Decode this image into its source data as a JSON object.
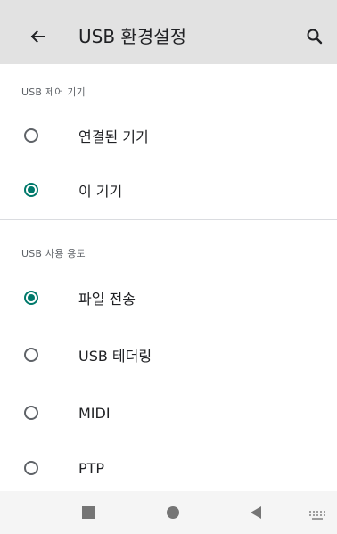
{
  "toolbar": {
    "title": "USB 환경설정",
    "back_icon": "arrow-left-icon",
    "search_icon": "search-icon"
  },
  "sections": [
    {
      "header": "USB 제어 기기",
      "options": [
        {
          "label": "연결된 기기",
          "selected": false
        },
        {
          "label": "이 기기",
          "selected": true
        }
      ]
    },
    {
      "header": "USB 사용 용도",
      "options": [
        {
          "label": "파일 전송",
          "selected": true
        },
        {
          "label": "USB 테더링",
          "selected": false
        },
        {
          "label": "MIDI",
          "selected": false
        },
        {
          "label": "PTP",
          "selected": false
        }
      ]
    }
  ],
  "navbar": {
    "recents_icon": "square-recents-icon",
    "home_icon": "circle-home-icon",
    "back_icon": "triangle-back-icon",
    "keyboard_icon": "keyboard-icon"
  },
  "colors": {
    "accent": "#00796b",
    "toolbar_bg": "#e2e2e2"
  }
}
